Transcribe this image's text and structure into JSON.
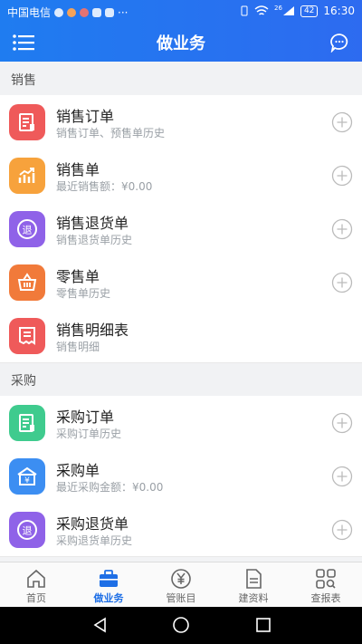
{
  "status_bar": {
    "carrier": "中国电信",
    "dots": "···",
    "signal_badge": "26",
    "battery": "42",
    "time": "16:30"
  },
  "header": {
    "title": "做业务"
  },
  "sections": {
    "sales": "销售",
    "purchase": "采购"
  },
  "rows": [
    {
      "title": "销售订单",
      "subtitle": "销售订单、预售单历史"
    },
    {
      "title": "销售单",
      "subtitle": "最近销售额：¥0.00"
    },
    {
      "title": "销售退货单",
      "subtitle": "销售退货单历史"
    },
    {
      "title": "零售单",
      "subtitle": "零售单历史"
    },
    {
      "title": "销售明细表",
      "subtitle": "销售明细"
    },
    {
      "title": "采购订单",
      "subtitle": "采购订单历史"
    },
    {
      "title": "采购单",
      "subtitle": "最近采购金额：¥0.00"
    },
    {
      "title": "采购退货单",
      "subtitle": "采购退货单历史"
    }
  ],
  "icon_glyphs": {
    "return": "退",
    "yuan": "¥"
  },
  "icon_names": [
    "document-icon",
    "chart-icon",
    "return-icon",
    "basket-icon",
    "receipt-icon",
    "document-icon",
    "money-box-icon",
    "return-icon"
  ],
  "colors": {
    "header_blue": "#2a73ee",
    "red": "#ef5a5a",
    "orange": "#f7a23c",
    "purple": "#8f62e8",
    "deep_orange": "#f17a3a",
    "green": "#3fcb8e",
    "blue": "#3c8ef2",
    "active_tab": "#1e6fe6"
  },
  "tabs": [
    {
      "label": "首页",
      "icon": "home-icon"
    },
    {
      "label": "做业务",
      "icon": "briefcase-icon"
    },
    {
      "label": "管账目",
      "icon": "yuan-coin-icon"
    },
    {
      "label": "建资料",
      "icon": "file-icon"
    },
    {
      "label": "查报表",
      "icon": "grid-search-icon"
    }
  ],
  "active_tab": "做业务"
}
